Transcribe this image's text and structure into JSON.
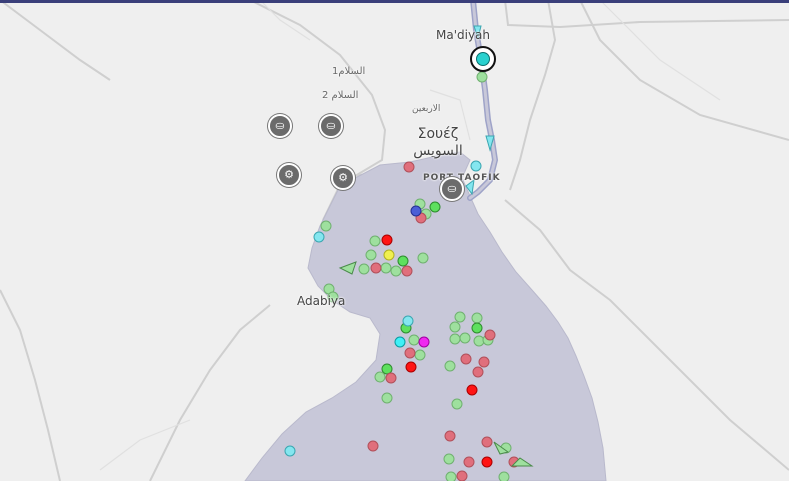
{
  "colors": {
    "land": "#efefef",
    "water": "#c8c8d9",
    "road": "#c9c9c9",
    "canal": "#8a8fb8",
    "vessel_green": "#9ee09e",
    "vessel_green_active": "#5ee05e",
    "vessel_red": "#e06f7c",
    "vessel_red_active": "#ff1414",
    "vessel_cyan": "#84e6ef",
    "vessel_magenta": "#f028f0",
    "vessel_yellow": "#f0f050",
    "vessel_blue": "#4a5fd6"
  },
  "labels": {
    "madiyah": "Ma'diyah",
    "salam1": "السلام1",
    "salam2": "السلام 2",
    "arbain": "الاربعين",
    "suez_greek": "Σουέζ",
    "suez_arabic": "السويس",
    "port_tawfik": "PORT TAOFIK",
    "adabiya": "Adabiya"
  },
  "icons": {
    "port": "port-basket-icon",
    "anchorage": "gear-icon",
    "selected_vessel": "target-icon"
  },
  "vessel_types": [
    "cargo-green",
    "tanker-red",
    "passenger-cyan",
    "other-magenta",
    "special-yellow",
    "highspeed-blue"
  ]
}
